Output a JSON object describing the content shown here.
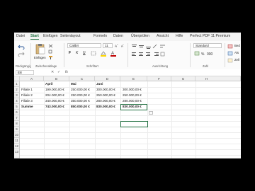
{
  "ribbon_tabs": [
    "Datei",
    "Start",
    "Einfügen",
    "Seitenlayout",
    "Formeln",
    "Daten",
    "Überprüfen",
    "Ansicht",
    "Hilfe",
    "Perfect PDF 11 Premium"
  ],
  "active_tab": "Start",
  "groups": {
    "clipboard": "Rückgängig",
    "clipboard2": "Zwischenablage",
    "font": "Schriftart",
    "alignment": "Ausrichtung",
    "number": "Zahl"
  },
  "font": {
    "name": "Calibri",
    "size": "11"
  },
  "clipboard_paste": "Einfügen",
  "number_format": "Standard",
  "right_labels": [
    "Bed",
    "Als",
    "Zell"
  ],
  "formula_bar": {
    "name_box": "E8",
    "fx": "fx",
    "cancel": "✕",
    "enter": "✓"
  },
  "columns": [
    "A",
    "B",
    "C",
    "D",
    "E",
    "F",
    "G",
    "H"
  ],
  "rows": [
    "1",
    "2",
    "3",
    "4",
    "5",
    "6",
    "7",
    "8",
    "9",
    "10",
    "11",
    "12",
    "13"
  ],
  "table": {
    "headers": [
      "",
      "April",
      "Mai",
      "Juni",
      ""
    ],
    "data": [
      [
        "Filiale 1",
        "199.000,00 €",
        "250.000,00 €",
        "300.000,00 €",
        "300.000,00 €"
      ],
      [
        "Filiale 2",
        "204.000,00 €",
        "250.000,00 €",
        "250.000,00 €",
        "250.000,00 €"
      ],
      [
        "Filiale 3",
        "340.000,00 €",
        "350.000,00 €",
        "280.000,00 €",
        "280.000,00 €"
      ]
    ],
    "sum": [
      "Summe",
      "743.000,00 €",
      "850.000,00 €",
      "830.000,00 €",
      "830.000,00 €"
    ]
  },
  "colors": {
    "accent": "#1e6e3e",
    "font_red": "#c00000",
    "fill_yellow": "#ffd700"
  }
}
